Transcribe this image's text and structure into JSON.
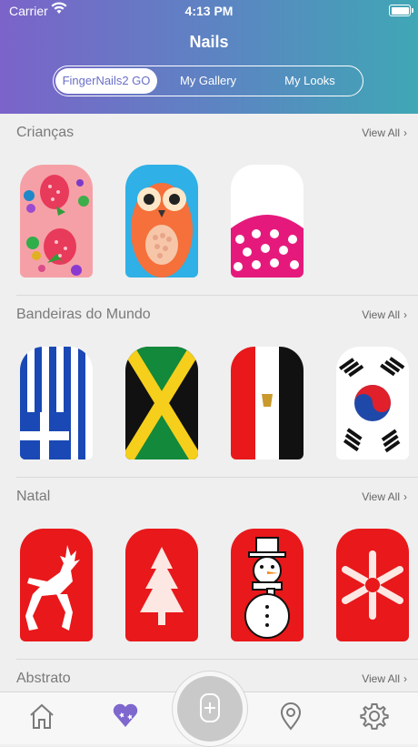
{
  "status_bar": {
    "carrier": "Carrier",
    "time": "4:13 PM"
  },
  "header": {
    "title": "Nails"
  },
  "segments": [
    {
      "label": "FingerNails2 GO",
      "active": true
    },
    {
      "label": "My Gallery",
      "active": false
    },
    {
      "label": "My Looks",
      "active": false
    }
  ],
  "sections": [
    {
      "title": "Crianças",
      "view_all": "View All",
      "nails": [
        "strawberry-nail",
        "owl-nail",
        "polka-dot-nail"
      ]
    },
    {
      "title": "Bandeiras do Mundo",
      "view_all": "View All",
      "nails": [
        "greece-flag-nail",
        "jamaica-flag-nail",
        "egypt-flag-nail",
        "korea-flag-nail"
      ]
    },
    {
      "title": "Natal",
      "view_all": "View All",
      "nails": [
        "reindeer-nail",
        "tree-nail",
        "snowman-nail",
        "snowflake-nail"
      ]
    },
    {
      "title": "Abstrato",
      "view_all": "View All",
      "nails": []
    }
  ],
  "colors": {
    "header_start": "#7b63c9",
    "header_end": "#3fa7b5",
    "accent": "#6a6fc7",
    "nail_red": "#e8181b"
  },
  "tabbar": {
    "items": [
      "home-icon",
      "hearts-icon",
      "add-nail-icon",
      "location-pin-icon",
      "gear-icon"
    ]
  }
}
